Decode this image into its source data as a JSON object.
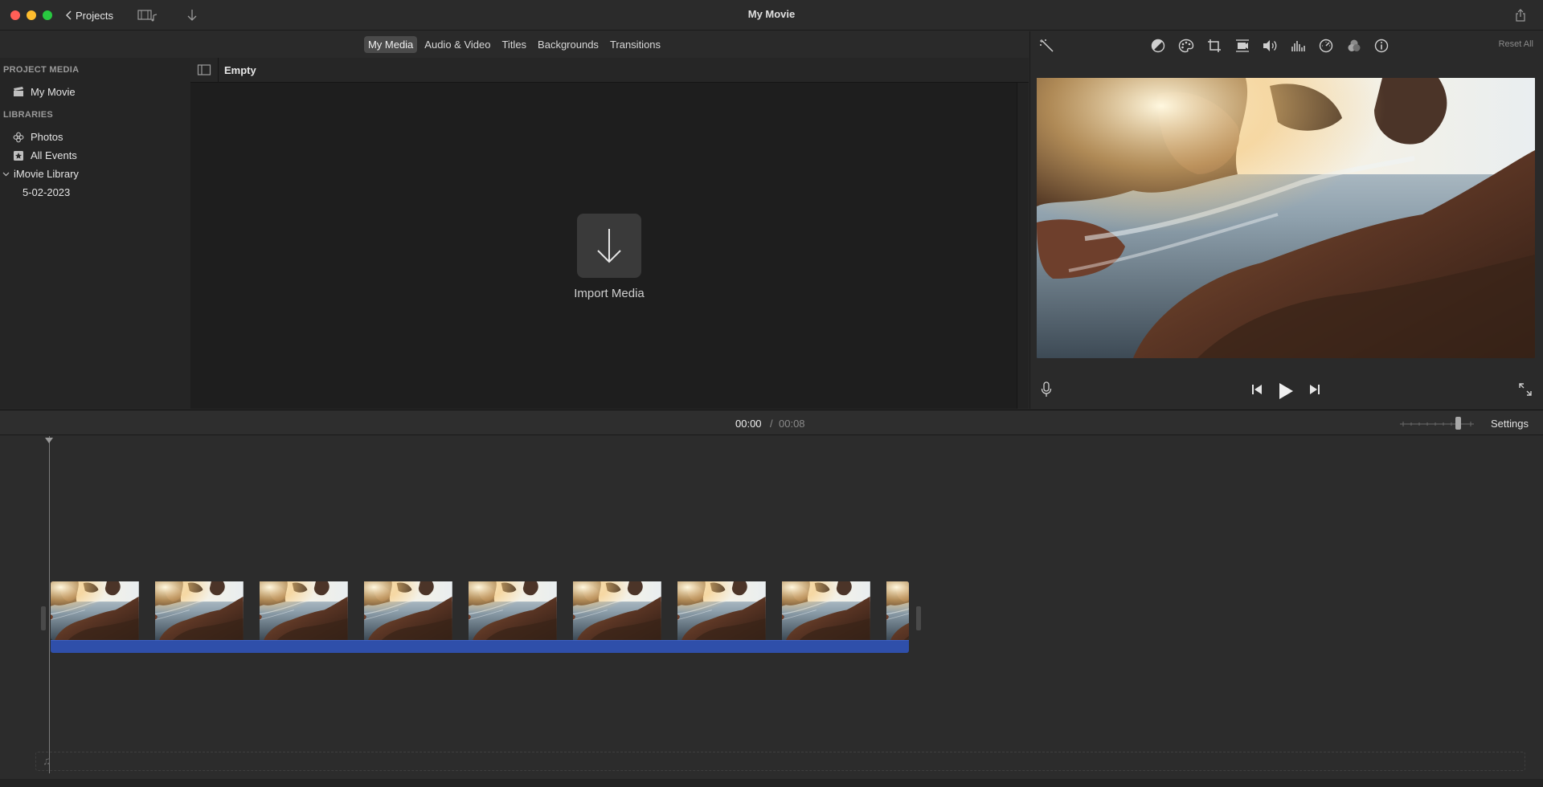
{
  "window": {
    "title": "My Movie",
    "projects_label": "Projects"
  },
  "browser": {
    "tabs": [
      {
        "label": "My Media",
        "active": true
      },
      {
        "label": "Audio & Video",
        "active": false
      },
      {
        "label": "Titles",
        "active": false
      },
      {
        "label": "Backgrounds",
        "active": false
      },
      {
        "label": "Transitions",
        "active": false
      }
    ],
    "content_header": "Empty",
    "import_label": "Import Media"
  },
  "sidebar": {
    "project_media_header": "PROJECT MEDIA",
    "project_item": "My Movie",
    "libraries_header": "LIBRARIES",
    "items": [
      {
        "label": "Photos",
        "icon": "photos-icon"
      },
      {
        "label": "All Events",
        "icon": "star-icon"
      },
      {
        "label": "iMovie Library",
        "icon": "chevron-down-icon"
      },
      {
        "label": "5-02-2023",
        "icon": ""
      }
    ]
  },
  "viewer": {
    "reset_all": "Reset All",
    "tools": [
      "magic-wand-icon",
      "color-balance-icon",
      "color-correction-icon",
      "crop-icon",
      "stabilization-icon",
      "volume-icon",
      "noise-reduction-icon",
      "speed-icon",
      "clip-filter-icon",
      "info-icon"
    ]
  },
  "timeline": {
    "current_time": "00:00",
    "separator": "/",
    "total_time": "00:08",
    "settings_label": "Settings",
    "clip_frames": 9
  },
  "colors": {
    "accent_audio": "#2f4faa",
    "traffic_red": "#ff5f57",
    "traffic_yellow": "#febc2e",
    "traffic_green": "#28c840"
  }
}
